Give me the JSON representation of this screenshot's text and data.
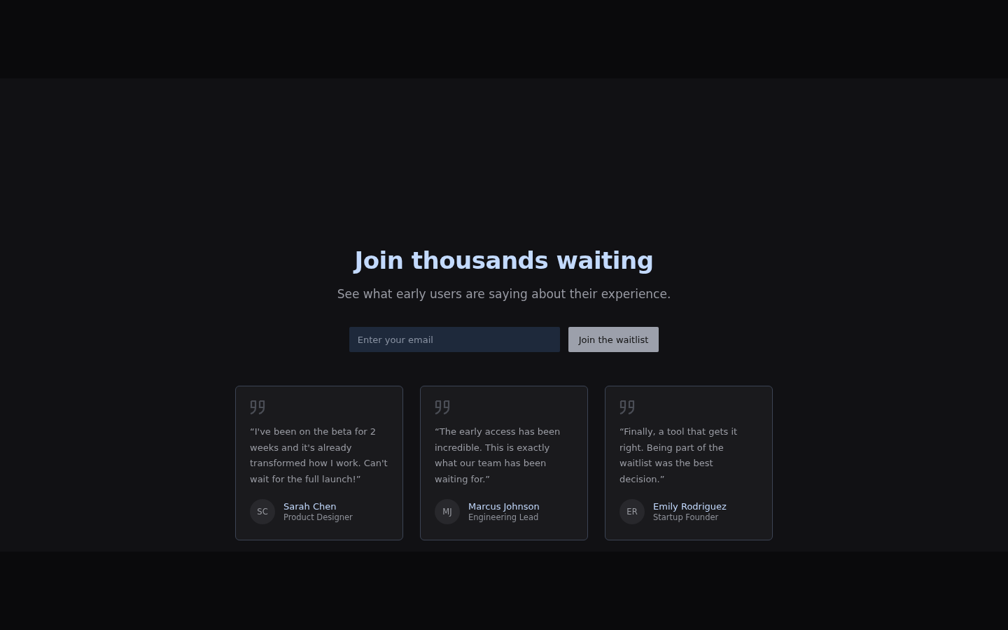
{
  "heading": "Join thousands waiting",
  "subheading": "See what early users are saying about their experience.",
  "signup": {
    "placeholder": "Enter your email",
    "button": "Join the waitlist"
  },
  "testimonials": [
    {
      "quote": "“I've been on the beta for 2 weeks and it's already transformed how I work. Can't wait for the full launch!”",
      "initials": "SC",
      "name": "Sarah Chen",
      "role": "Product Designer"
    },
    {
      "quote": "“The early access has been incredible. This is exactly what our team has been waiting for.”",
      "initials": "MJ",
      "name": "Marcus Johnson",
      "role": "Engineering Lead"
    },
    {
      "quote": "“Finally, a tool that gets it right. Being part of the waitlist was the best decision.”",
      "initials": "ER",
      "name": "Emily Rodriguez",
      "role": "Startup Founder"
    }
  ]
}
